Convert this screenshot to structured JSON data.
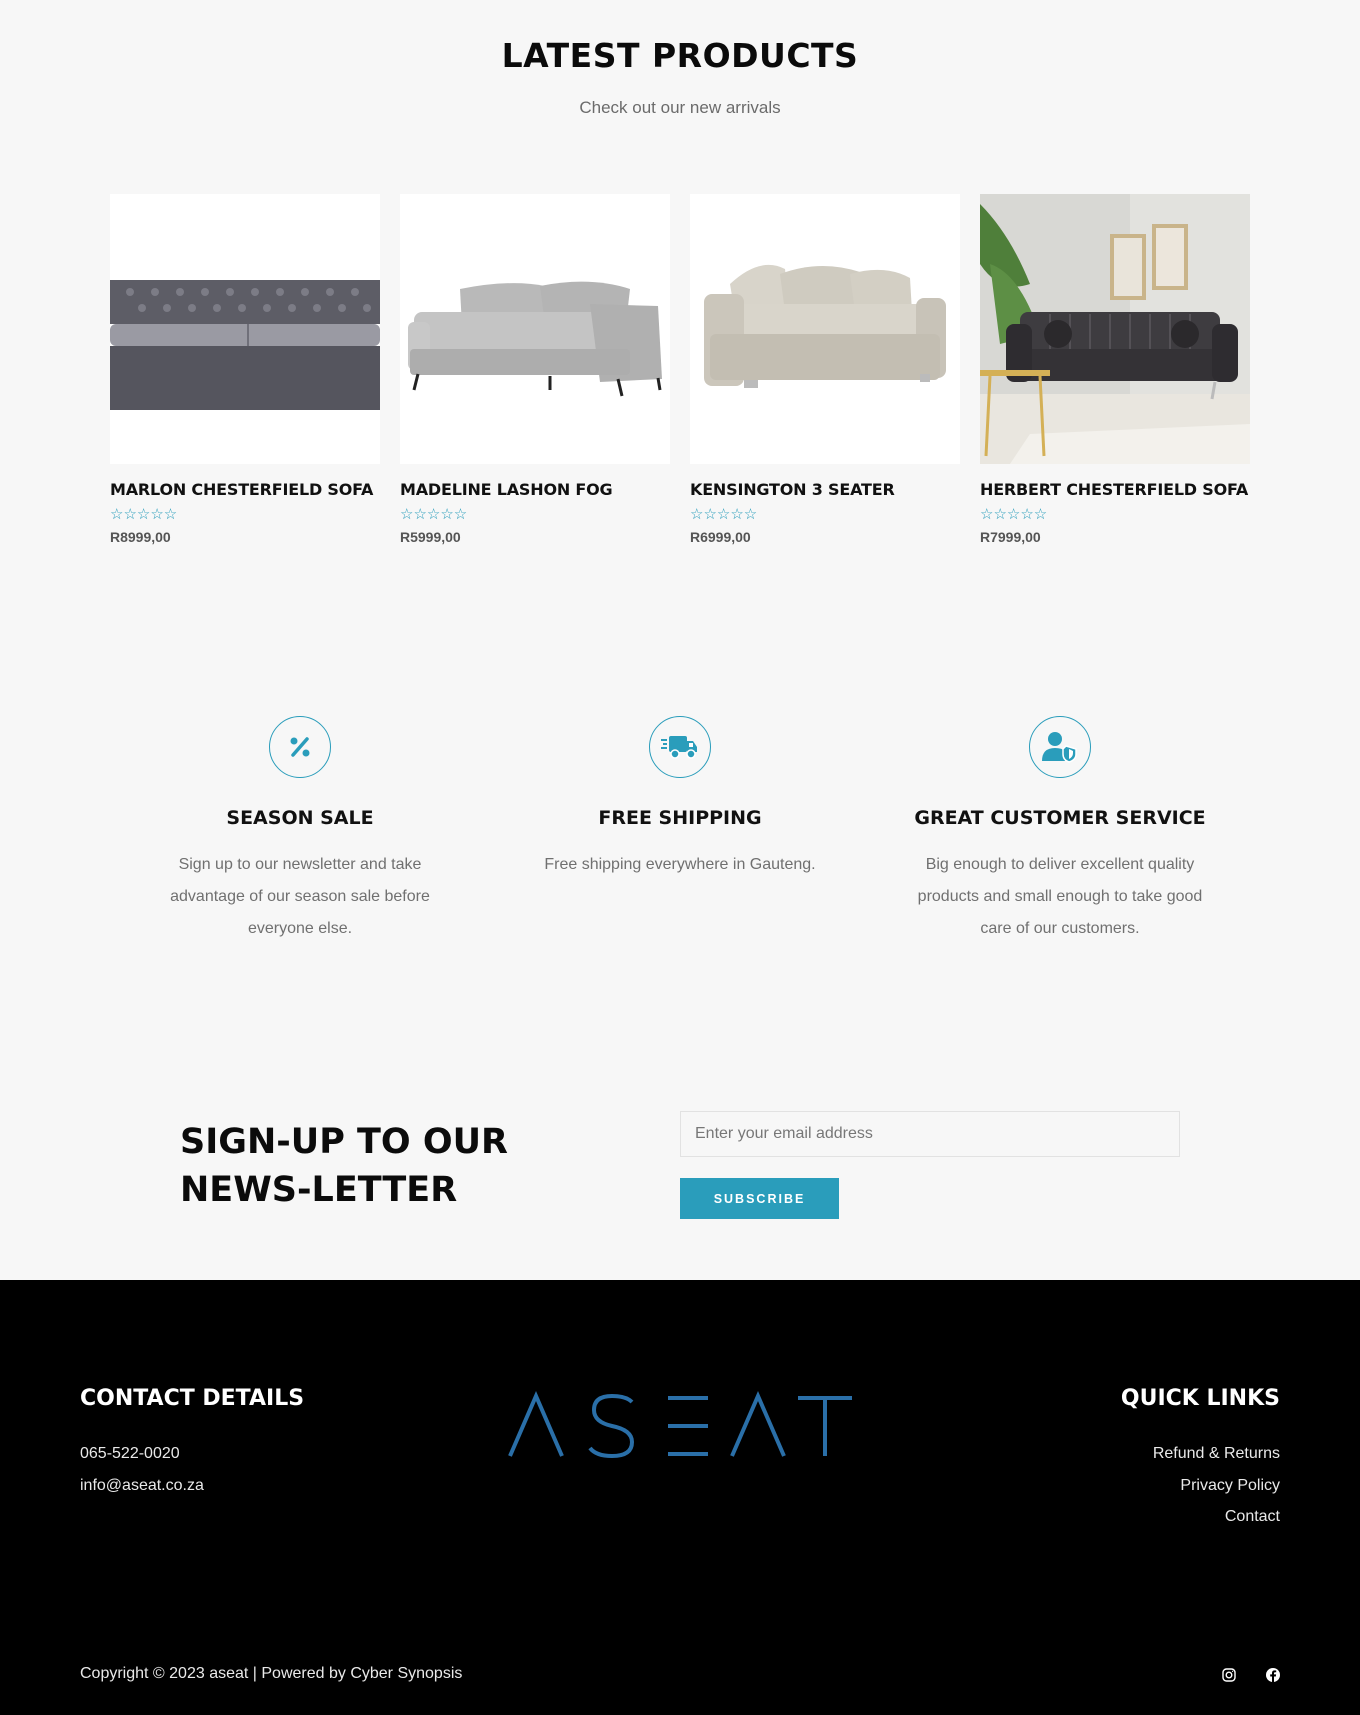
{
  "section": {
    "title": "LATEST PRODUCTS",
    "subtitle": "Check out our new arrivals"
  },
  "products": [
    {
      "name": "MARLON CHESTERFIELD SOFA",
      "price": "R8999,00",
      "rating": 0,
      "stars": "☆☆☆☆☆"
    },
    {
      "name": "MADELINE LASHON FOG",
      "price": "R5999,00",
      "rating": 0,
      "stars": "☆☆☆☆☆"
    },
    {
      "name": "KENSINGTON 3 SEATER",
      "price": "R6999,00",
      "rating": 0,
      "stars": "☆☆☆☆☆"
    },
    {
      "name": "HERBERT CHESTERFIELD SOFA",
      "price": "R7999,00",
      "rating": 0,
      "stars": "☆☆☆☆☆"
    }
  ],
  "features": [
    {
      "icon": "percent-icon",
      "title": "SEASON SALE",
      "text": "Sign up to our newsletter and take advantage of our season sale before everyone else."
    },
    {
      "icon": "delivery-truck-icon",
      "title": "FREE SHIPPING",
      "text": "Free shipping everywhere in Gauteng."
    },
    {
      "icon": "user-shield-icon",
      "title": "GREAT CUSTOMER SERVICE",
      "text": "Big enough to deliver excellent quality products and small enough to take good care of our customers."
    }
  ],
  "newsletter": {
    "title": "SIGN-UP TO OUR NEWS-LETTER",
    "email_placeholder": "Enter your email address",
    "email_value": "",
    "button_label": "SUBSCRIBE"
  },
  "footer": {
    "contact_heading": "CONTACT DETAILS",
    "phone": "065-522-0020",
    "email": "info@aseat.co.za",
    "logo_text": "ASEAT",
    "quick_links_heading": "QUICK LINKS",
    "links": [
      "Refund & Returns",
      "Privacy Policy",
      "Contact"
    ],
    "copyright": "Copyright © 2023 aseat | Powered by Cyber Synopsis",
    "social": [
      "instagram-icon",
      "facebook-icon"
    ]
  },
  "colors": {
    "accent": "#2a9dbb",
    "logo_blue": "#2a6fa8",
    "background": "#f7f7f7",
    "footer_bg": "#000000"
  }
}
